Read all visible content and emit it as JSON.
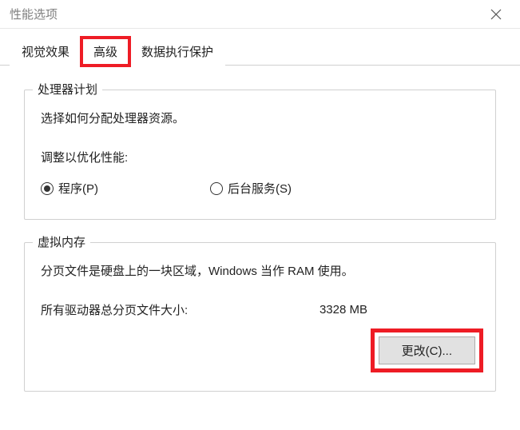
{
  "window": {
    "title": "性能选项"
  },
  "tabs": {
    "visual_effects": "视觉效果",
    "advanced": "高级",
    "dep": "数据执行保护"
  },
  "processor": {
    "group_title": "处理器计划",
    "description": "选择如何分配处理器资源。",
    "adjust_label": "调整以优化性能:",
    "option_programs": "程序(P)",
    "option_background": "后台服务(S)"
  },
  "virtual_memory": {
    "group_title": "虚拟内存",
    "description": "分页文件是硬盘上的一块区域，Windows 当作 RAM 使用。",
    "total_label": "所有驱动器总分页文件大小:",
    "total_value": "3328 MB",
    "change_button": "更改(C)..."
  }
}
